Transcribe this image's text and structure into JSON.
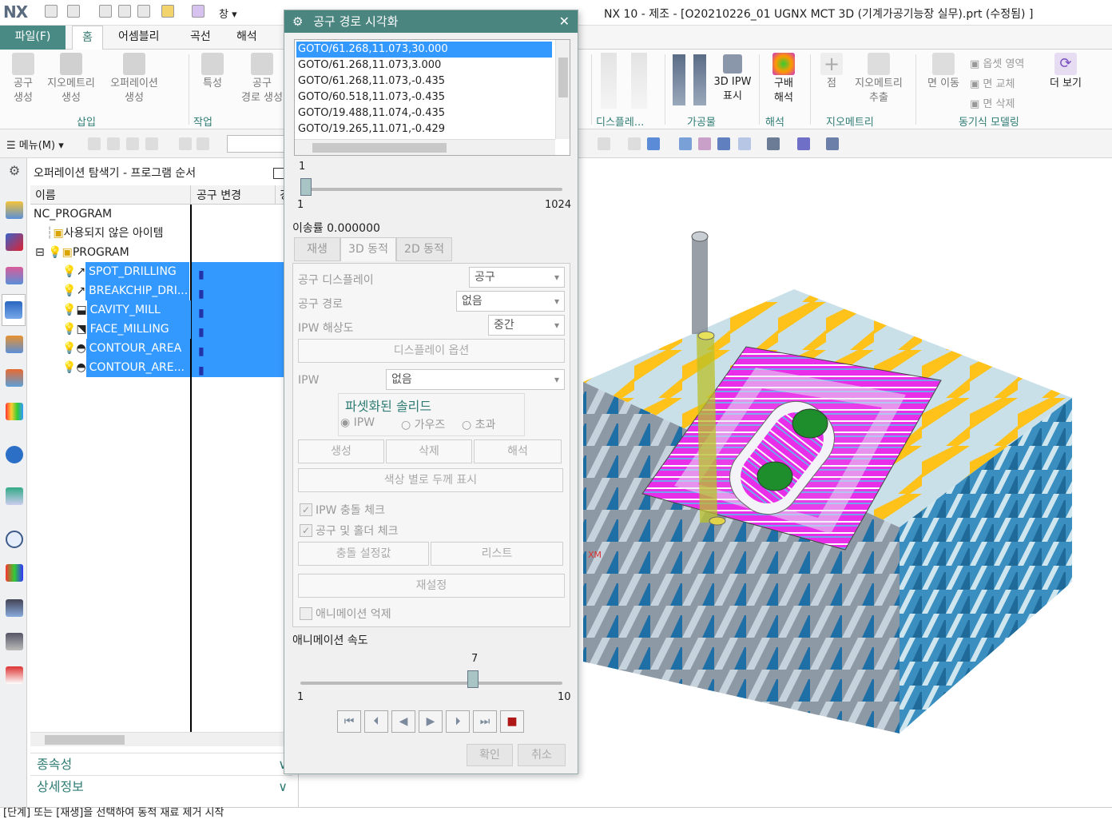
{
  "window_title": "NX 10 - 제조 - [O20210226_01 UGNX MCT 3D (기계가공기능장 실무).prt (수정됨) ]",
  "logo": "NX",
  "window_menu": "창",
  "menu_tabs": [
    "파일(F)",
    "홈",
    "어셈블리",
    "곡선",
    "해석"
  ],
  "ribbon": {
    "buttons": [
      {
        "label": "공구\n생성"
      },
      {
        "label": "지오메트리\n생성"
      },
      {
        "label": "오퍼레이션\n생성"
      },
      {
        "label": "특성"
      },
      {
        "label": "공구\n경로 생성"
      }
    ],
    "right_buttons": [
      "3D IPW\n표시",
      "구배\n해석",
      "점",
      "지오메트리\n추출",
      "면 이동",
      "더 보기"
    ],
    "right_small": [
      "옵셋 영역",
      "면 교체",
      "면 삭제"
    ],
    "groups": [
      "삽입",
      "작업",
      "디스플레...",
      "가공물",
      "해석",
      "지오메트리",
      "동기식 모델링"
    ]
  },
  "toolbar2": {
    "menu_label": "메뉴(M)"
  },
  "navigator": {
    "title": "오퍼레이션 탐색기 - 프로그램 순서",
    "col_name": "이름",
    "col_tool_change": "공구 변경",
    "col_extra": "경",
    "rows": [
      {
        "name": "NC_PROGRAM"
      },
      {
        "name": "사용되지 않은 아이템"
      },
      {
        "name": "PROGRAM"
      },
      {
        "name": "SPOT_DRILLING"
      },
      {
        "name": "BREAKCHIP_DRI..."
      },
      {
        "name": "CAVITY_MILL"
      },
      {
        "name": "FACE_MILLING"
      },
      {
        "name": "CONTOUR_AREA"
      },
      {
        "name": "CONTOUR_ARE..."
      }
    ],
    "sections": [
      "종속성",
      "상세정보"
    ]
  },
  "dialog": {
    "title": "공구 경로 시각화",
    "list": [
      "GOTO/61.268,11.073,30.000",
      "GOTO/61.268,11.073,3.000",
      "GOTO/61.268,11.073,-0.435",
      "GOTO/60.518,11.073,-0.435",
      "GOTO/19.488,11.074,-0.435",
      "GOTO/19.265,11.071,-0.429"
    ],
    "slider_value": "1",
    "slider_min": "1",
    "slider_max": "1024",
    "feed_rate": "이송률 0.000000",
    "tabs": [
      "재생",
      "3D 동적",
      "2D 동적"
    ],
    "tool_display_label": "공구 디스플레이",
    "tool_display_value": "공구",
    "tool_path_label": "공구 경로",
    "tool_path_value": "없음",
    "ipw_res_label": "IPW 해상도",
    "ipw_res_value": "중간",
    "display_options": "디스플레이 옵션",
    "ipw_label": "IPW",
    "ipw_value": "없음",
    "faceted_solid": "파셋화된 솔리드",
    "radio": [
      "IPW",
      "가우즈",
      "초과"
    ],
    "btn_create": "생성",
    "btn_delete": "삭제",
    "btn_analyze": "해석",
    "btn_color_thickness": "색상 별로 두께 표시",
    "chk_ipw_collision": "IPW 충돌 체크",
    "chk_tool_holder": "공구 및 홀더 체크",
    "btn_collision_settings": "충돌 설정값",
    "btn_list": "리스트",
    "btn_reset": "재설정",
    "chk_suppress_anim": "애니메이션 억제",
    "anim_speed_label": "애니메이션 속도",
    "anim_speed_value": "7",
    "anim_min": "1",
    "anim_max": "10",
    "ok": "확인",
    "cancel": "취소"
  },
  "status": "[단계] 또는 [재생]을 선택하여 동적 재료 제거 시작",
  "viewport_label": "XM"
}
